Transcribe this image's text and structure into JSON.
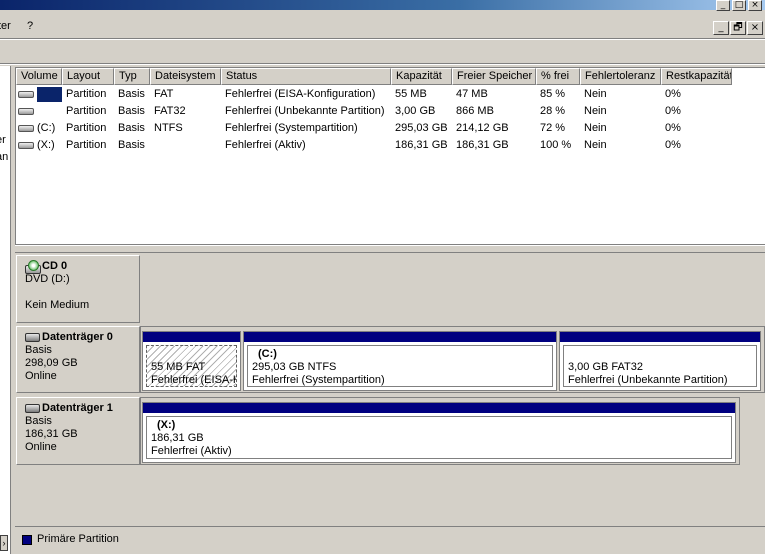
{
  "window": {
    "controls": [
      "_",
      "□",
      "×"
    ],
    "mdi_controls": [
      "_",
      "🗗",
      "×"
    ]
  },
  "menu": {
    "items": [
      "ter",
      "?"
    ]
  },
  "left_pane": {
    "fragments": [
      "er",
      "an"
    ]
  },
  "volume_list": {
    "columns": [
      "Volume",
      "Layout",
      "Typ",
      "Dateisystem",
      "Status",
      "Kapazität",
      "Freier Speicher",
      "% frei",
      "Fehlertoleranz",
      "Restkapazität"
    ],
    "rows": [
      {
        "volume": "",
        "layout": "Partition",
        "typ": "Basis",
        "fs": "FAT",
        "status": "Fehlerfrei (EISA-Konfiguration)",
        "kap": "55 MB",
        "frei": "47 MB",
        "pct": "85 %",
        "ft": "Nein",
        "rest": "0%"
      },
      {
        "volume": "",
        "layout": "Partition",
        "typ": "Basis",
        "fs": "FAT32",
        "status": "Fehlerfrei (Unbekannte Partition)",
        "kap": "3,00 GB",
        "frei": "866 MB",
        "pct": "28 %",
        "ft": "Nein",
        "rest": "0%"
      },
      {
        "volume": "(C:)",
        "layout": "Partition",
        "typ": "Basis",
        "fs": "NTFS",
        "status": "Fehlerfrei (Systempartition)",
        "kap": "295,03 GB",
        "frei": "214,12 GB",
        "pct": "72 %",
        "ft": "Nein",
        "rest": "0%"
      },
      {
        "volume": "(X:)",
        "layout": "Partition",
        "typ": "Basis",
        "fs": "",
        "status": "Fehlerfrei (Aktiv)",
        "kap": "186,31 GB",
        "frei": "186,31 GB",
        "pct": "100 %",
        "ft": "Nein",
        "rest": "0%"
      }
    ]
  },
  "disks": {
    "cd0": {
      "name": "CD 0",
      "type": "DVD (D:)",
      "medium": "Kein Medium"
    },
    "disk0": {
      "name": "Datenträger 0",
      "kind": "Basis",
      "size": "298,09 GB",
      "state": "Online",
      "partitions": [
        {
          "drive": "",
          "line1": "55 MB FAT",
          "line2": "Fehlerfrei (EISA-K"
        },
        {
          "drive": "(C:)",
          "line1": "295,03 GB NTFS",
          "line2": "Fehlerfrei (Systempartition)"
        },
        {
          "drive": "",
          "line1": "3,00 GB FAT32",
          "line2": "Fehlerfrei (Unbekannte Partition)"
        }
      ]
    },
    "disk1": {
      "name": "Datenträger 1",
      "kind": "Basis",
      "size": "186,31 GB",
      "state": "Online",
      "partitions": [
        {
          "drive": "(X:)",
          "line1": "186,31 GB",
          "line2": "Fehlerfrei (Aktiv)"
        }
      ]
    }
  },
  "legend": {
    "primary_label": "Primäre Partition",
    "primary_color": "#000080"
  },
  "colors": {
    "partition_bar": "#000080",
    "selection": "#0a246a"
  }
}
